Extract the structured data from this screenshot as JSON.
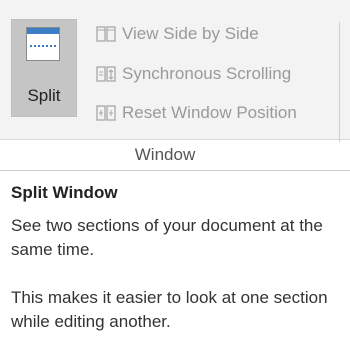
{
  "ribbon": {
    "split": {
      "label": "Split",
      "icon": "split-window-icon"
    },
    "commands": [
      {
        "label": "View Side by Side",
        "icon": "view-side-by-side-icon"
      },
      {
        "label": "Synchronous Scrolling",
        "icon": "synchronous-scrolling-icon"
      },
      {
        "label": "Reset Window Position",
        "icon": "reset-window-position-icon"
      }
    ],
    "group_label": "Window"
  },
  "tooltip": {
    "title": "Split Window",
    "paragraph1": "See two sections of your document at the same time.",
    "paragraph2": "This makes it easier to look at one section while editing another."
  },
  "colors": {
    "ribbon_bg": "#f3f3f3",
    "split_selected_bg": "#c5c5c5",
    "icon_accent": "#3c7dc4",
    "disabled_text": "#9a9a9a"
  }
}
